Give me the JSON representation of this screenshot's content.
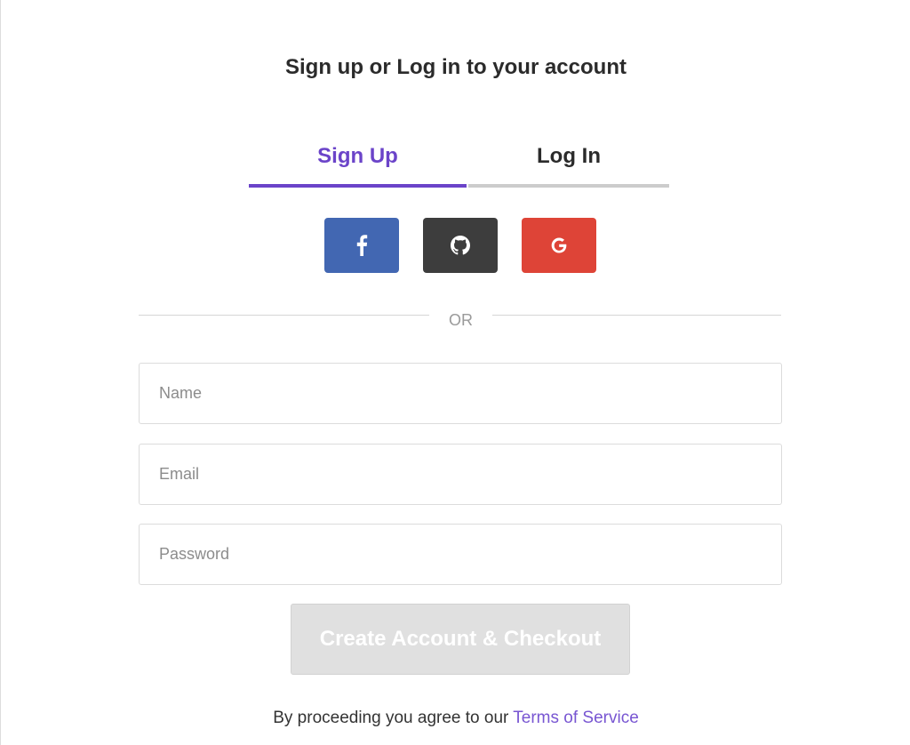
{
  "page": {
    "heading": "Sign up or Log in to your account"
  },
  "tabs": [
    {
      "label": "Sign Up",
      "active": true
    },
    {
      "label": "Log In",
      "active": false
    }
  ],
  "social": [
    {
      "name": "facebook",
      "icon": "facebook-icon",
      "color": "#4267b2"
    },
    {
      "name": "github",
      "icon": "github-icon",
      "color": "#3d3d3d"
    },
    {
      "name": "google",
      "icon": "google-icon",
      "color": "#de4437"
    }
  ],
  "divider": {
    "label": "OR"
  },
  "form": {
    "name_placeholder": "Name",
    "name_value": "",
    "email_placeholder": "Email",
    "email_value": "",
    "password_placeholder": "Password",
    "password_value": "",
    "submit_label": "Create Account & Checkout"
  },
  "terms": {
    "prefix": "By proceeding you agree to our",
    "link_label": "Terms of Service"
  },
  "colors": {
    "accent": "#6b44c9",
    "link": "#7856d2",
    "submit_disabled": "#e0e0e0"
  }
}
